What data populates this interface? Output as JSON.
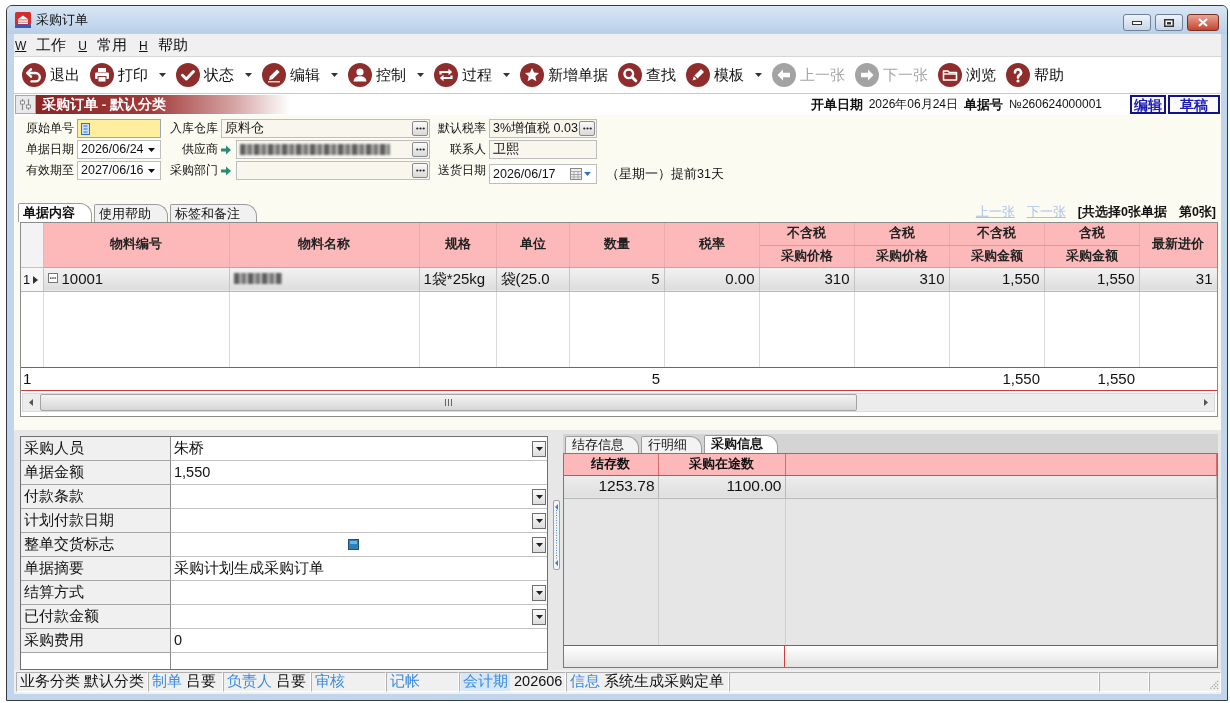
{
  "window": {
    "title": "采购订单"
  },
  "menu": [
    {
      "key": "W",
      "label": "工作"
    },
    {
      "key": "U",
      "label": "常用"
    },
    {
      "key": "H",
      "label": "帮助"
    }
  ],
  "toolbar": [
    {
      "kind": "exit",
      "label": "退出",
      "dropdown": false,
      "disabled": false
    },
    {
      "kind": "print",
      "label": "打印",
      "dropdown": true,
      "disabled": false
    },
    {
      "kind": "status",
      "label": "状态",
      "dropdown": true,
      "disabled": false
    },
    {
      "kind": "edit",
      "label": "编辑",
      "dropdown": true,
      "disabled": false
    },
    {
      "kind": "control",
      "label": "控制",
      "dropdown": true,
      "disabled": false
    },
    {
      "kind": "process",
      "label": "过程",
      "dropdown": true,
      "disabled": false
    },
    {
      "kind": "new",
      "label": "新增单据",
      "dropdown": false,
      "disabled": false
    },
    {
      "kind": "find",
      "label": "查找",
      "dropdown": false,
      "disabled": false
    },
    {
      "kind": "template",
      "label": "模板",
      "dropdown": true,
      "disabled": false
    },
    {
      "kind": "previous",
      "label": "上一张",
      "dropdown": false,
      "disabled": true
    },
    {
      "kind": "next",
      "label": "下一张",
      "dropdown": false,
      "disabled": true
    },
    {
      "kind": "browse",
      "label": "浏览",
      "dropdown": false,
      "disabled": false
    },
    {
      "kind": "help",
      "label": "帮助",
      "dropdown": false,
      "disabled": false
    }
  ],
  "document_header": {
    "title": "采购订单 - 默认分类",
    "date_label": "开单日期",
    "date": "2026年06月24日",
    "number_label": "单据号",
    "number": "№260624000001",
    "buttons": [
      "编辑",
      "草稿"
    ]
  },
  "form": {
    "rows": [
      {
        "fields": [
          {
            "label": "原始单号",
            "kind": "text",
            "focused": true,
            "redacted": false
          },
          {
            "label": "入库仓库",
            "kind": "lookup",
            "value": "原料仓",
            "focused": false,
            "redacted": false
          },
          {
            "label": "默认税率",
            "kind": "lookup",
            "value": "3%增值税 0.03",
            "focused": false,
            "redacted": false
          }
        ]
      },
      {
        "fields": [
          {
            "label": "单据日期",
            "kind": "date",
            "value": "2026/06/24",
            "focused": false,
            "redacted": false
          },
          {
            "label": "供应商",
            "kind": "linked_lookup",
            "focused": false,
            "redacted": true
          },
          {
            "label": "联系人",
            "kind": "text",
            "value": "卫熙",
            "focused": false,
            "redacted": false
          }
        ]
      },
      {
        "fields": [
          {
            "label": "有效期至",
            "kind": "date",
            "value": "2027/06/16",
            "focused": false,
            "redacted": false
          },
          {
            "label": "采购部门",
            "kind": "linked_lookup",
            "focused": false,
            "redacted": false
          },
          {
            "label": "送货日期",
            "kind": "calendar",
            "value": "2026/06/17",
            "note": "（星期一）提前31天",
            "focused": false,
            "redacted": false
          }
        ]
      }
    ]
  },
  "document_tabs": [
    {
      "label": "单据内容",
      "selected": true
    },
    {
      "label": "使用帮助",
      "selected": false
    },
    {
      "label": "标签和备注",
      "selected": false
    }
  ],
  "record_nav": [
    {
      "label": "上一张",
      "disabled": true
    },
    {
      "label": "下一张",
      "disabled": true
    }
  ],
  "selection_info": {
    "count": "[共选择0张单据",
    "position": "第0张]"
  },
  "items_table": {
    "columns": [
      {
        "label": "物料编号",
        "kind": "code"
      },
      {
        "label": "物料名称",
        "kind": "text"
      },
      {
        "label": "规格",
        "kind": "text"
      },
      {
        "label": "单位",
        "kind": "text"
      },
      {
        "label": "数量",
        "kind": "number",
        "total": "5"
      },
      {
        "label": "税率",
        "kind": "number"
      },
      {
        "group": "不含税",
        "label": "采购价格",
        "kind": "number"
      },
      {
        "group": "含税",
        "label": "采购价格",
        "kind": "number"
      },
      {
        "group": "不含税",
        "label": "采购金额",
        "kind": "number",
        "total": "1,550"
      },
      {
        "group": "含税",
        "label": "采购金额",
        "kind": "number",
        "total": "1,550"
      },
      {
        "label": "最新进价",
        "kind": "number"
      }
    ],
    "rows": [
      {
        "number": "1",
        "current": true,
        "cells": [
          {
            "text": "10001",
            "redacted": false
          },
          {
            "redacted": true
          },
          {
            "text": "1袋*25kg",
            "redacted": false
          },
          {
            "text": "袋(25.0",
            "redacted": false
          },
          {
            "text": "5",
            "redacted": false
          },
          {
            "text": "0.00",
            "redacted": false
          },
          {
            "text": "310",
            "redacted": false
          },
          {
            "text": "310",
            "redacted": false
          },
          {
            "text": "1,550",
            "redacted": false
          },
          {
            "text": "1,550",
            "redacted": false
          },
          {
            "text": "31",
            "redacted": false
          }
        ]
      }
    ],
    "total_count": "1"
  },
  "properties": [
    {
      "label": "采购人员",
      "value": "朱桥",
      "kind": "text",
      "dropdown": true
    },
    {
      "label": "单据金额",
      "value": "1,550",
      "kind": "text",
      "dropdown": false
    },
    {
      "label": "付款条款",
      "kind": "text",
      "dropdown": true
    },
    {
      "label": "计划付款日期",
      "kind": "text",
      "dropdown": true
    },
    {
      "label": "整单交货标志",
      "kind": "flag",
      "dropdown": true
    },
    {
      "label": "单据摘要",
      "value": "采购计划生成采购订单",
      "kind": "text",
      "dropdown": false
    },
    {
      "label": "结算方式",
      "kind": "text",
      "dropdown": true
    },
    {
      "label": "已付款金额",
      "kind": "text",
      "dropdown": true
    },
    {
      "label": "采购费用",
      "value": "0",
      "kind": "text",
      "dropdown": false
    }
  ],
  "detail_tabs": [
    {
      "label": "结存信息",
      "selected": false
    },
    {
      "label": "行明细",
      "selected": false
    },
    {
      "label": "采购信息",
      "selected": true
    }
  ],
  "detail_table": {
    "columns": [
      "结存数",
      "采购在途数"
    ],
    "rows": [
      {
        "cells": [
          "1253.78",
          "1100.00"
        ]
      }
    ]
  },
  "status_bar": [
    {
      "kind": "plain",
      "label": "业务分类",
      "value": "默认分类"
    },
    {
      "kind": "link",
      "label": "制单",
      "value": "吕要"
    },
    {
      "kind": "link",
      "label": "负责人",
      "value": "吕要"
    },
    {
      "kind": "link",
      "label": "审核"
    },
    {
      "kind": "link",
      "label": "记帐"
    },
    {
      "kind": "highlight",
      "label": "会计期",
      "value": "202606"
    },
    {
      "kind": "link",
      "label": "信息",
      "value": "系统生成采购定单"
    }
  ]
}
